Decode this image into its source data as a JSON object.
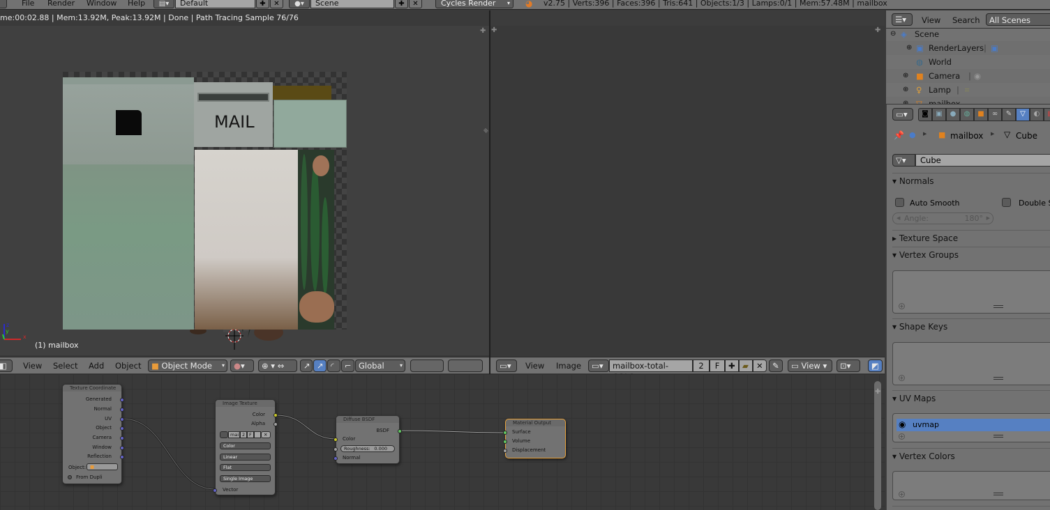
{
  "topbar": {
    "menus": [
      "File",
      "Render",
      "Window",
      "Help"
    ],
    "screen_layout": "Default",
    "scene": "Scene",
    "render_engine": "Cycles Render",
    "stats": "v2.75 | Verts:396 | Faces:396 | Tris:641 | Objects:1/3 | Lamps:0/1 | Mem:57.48M | mailbox"
  },
  "view3d": {
    "render_status": "me:00:02.88 | Mem:13.92M, Peak:13.92M | Done | Path Tracing Sample 76/76",
    "object_label": "(1) mailbox",
    "axis_labels": {
      "x": "x",
      "y": "y",
      "z": "z"
    },
    "model_text": "MAIL",
    "header": {
      "menus": [
        "View",
        "Select",
        "Add",
        "Object"
      ],
      "mode": "Object Mode",
      "orientation": "Global"
    }
  },
  "image_editor": {
    "texture_text": "MAIL",
    "header": {
      "menus": [
        "View",
        "Image"
      ],
      "image_name": "mailbox-total-COLO...",
      "users": "2",
      "fake_user": "F",
      "view_mode": "View"
    }
  },
  "node_editor": {
    "nodes": {
      "texcoord": {
        "title": "Texture Coordinate",
        "outputs": [
          "Generated",
          "Normal",
          "UV",
          "Object",
          "Camera",
          "Window",
          "Reflection"
        ],
        "object_label": "Object:",
        "from_dupli": "From Dupli"
      },
      "image_texture": {
        "title": "Image Texture",
        "outputs": [
          "Color",
          "Alpha"
        ],
        "image_name": "mai",
        "users": "2",
        "fake_user": "F",
        "color_space": "Color",
        "interpolation": "Linear",
        "projection": "Flat",
        "source": "Single Image",
        "input": "Vector"
      },
      "diffuse": {
        "title": "Diffuse BSDF",
        "output": "BSDF",
        "inputs": [
          "Color",
          "Normal"
        ],
        "roughness_label": "Roughness:",
        "roughness_value": "0.000"
      },
      "material_output": {
        "title": "Material Output",
        "inputs": [
          "Surface",
          "Volume",
          "Displacement"
        ]
      }
    },
    "colors": {
      "color_socket": "#c7c729",
      "vector_socket": "#6363c7",
      "shader_socket": "#63c763",
      "float_socket": "#a1a1a1",
      "active_node_border": "#e8a23a"
    }
  },
  "outliner": {
    "header": {
      "menus": [
        "View",
        "Search"
      ],
      "filter": "All Scenes"
    },
    "items": [
      {
        "label": "Scene",
        "icon": "scene-icon"
      },
      {
        "label": "RenderLayers",
        "icon": "renderlayers-icon"
      },
      {
        "label": "World",
        "icon": "world-icon"
      },
      {
        "label": "Camera",
        "icon": "camera-icon"
      },
      {
        "label": "Lamp",
        "icon": "lamp-icon"
      },
      {
        "label": "mailbox",
        "icon": "mesh-object-icon"
      }
    ]
  },
  "properties": {
    "breadcrumb": {
      "object": "mailbox",
      "mesh": "Cube"
    },
    "mesh_name": "Cube",
    "panels": {
      "normals": "Normals",
      "auto_smooth": "Auto Smooth",
      "double_sided": "Double Sided",
      "angle_label": "Angle:",
      "angle_value": "180°",
      "texture_space": "Texture Space",
      "vertex_groups": "Vertex Groups",
      "shape_keys": "Shape Keys",
      "uv_maps": "UV Maps",
      "uv_map_item": "uvmap",
      "vertex_colors": "Vertex Colors"
    },
    "colors": {
      "selected": "#5680c2",
      "active_tab": "#5680c2"
    }
  }
}
